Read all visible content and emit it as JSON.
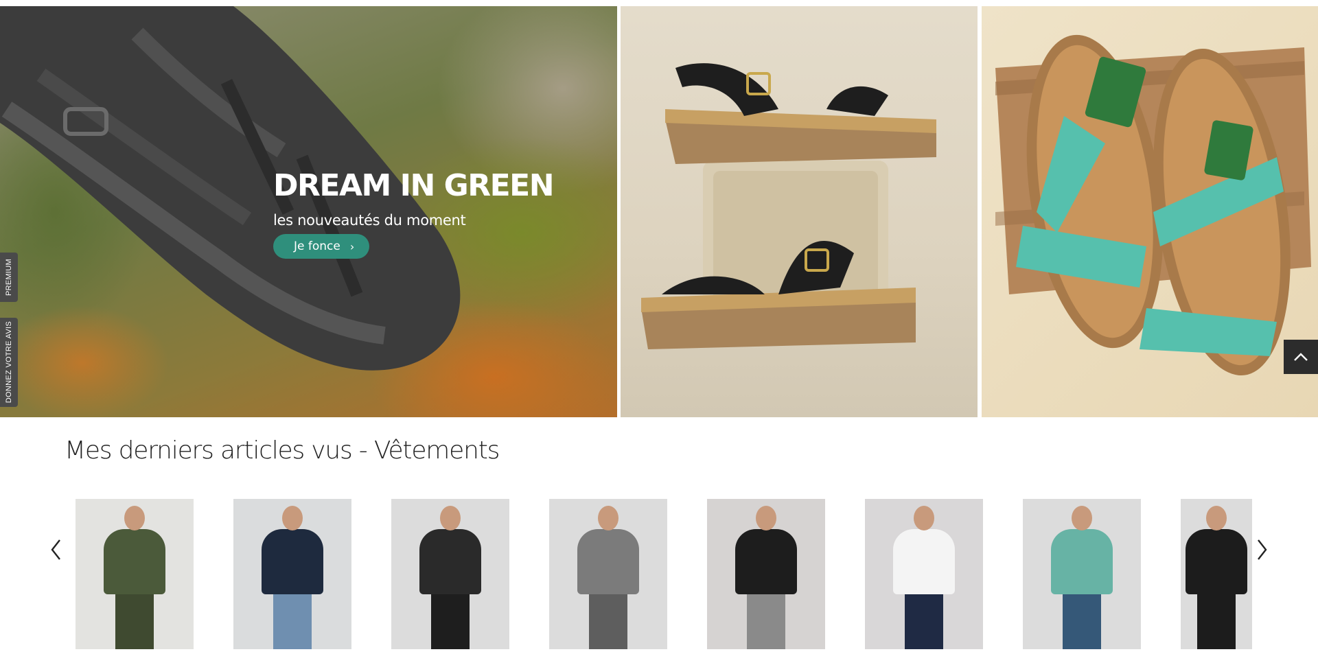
{
  "hero": {
    "title": "DREAM IN GREEN",
    "subtitle": "les nouveautés du moment",
    "cta_label": "Je fonce",
    "cta_icon": "chevron-right-icon",
    "accent_color": "#2f8f7c"
  },
  "side_tabs": {
    "premium": "PREMIUM",
    "review": "DONNEZ VOTRE AVIS"
  },
  "back_to_top_icon": "chevron-up-icon",
  "recent": {
    "title": "Mes derniers articles vus - Vêtements",
    "prev_icon": "chevron-left-icon",
    "next_icon": "chevron-right-icon",
    "products": [
      {
        "name": "khaki-tracksuit",
        "top_color": "#4b5a3a",
        "bottom_color": "#3f4a30",
        "bg": "#e3e3e0"
      },
      {
        "name": "striped-sweater-gilet",
        "top_color": "#1e2a3e",
        "bottom_color": "#6f8fb0",
        "bg": "#dadcdd"
      },
      {
        "name": "black-hoodie-olive-polo",
        "top_color": "#2a2a2a",
        "bottom_color": "#1e1e1e",
        "bg": "#dcdcdc"
      },
      {
        "name": "grey-tshirt",
        "top_color": "#7b7b7b",
        "bottom_color": "#5e5e5e",
        "bg": "#dcdcdc"
      },
      {
        "name": "black-leather-jacket",
        "top_color": "#1d1d1d",
        "bottom_color": "#8a8a8a",
        "bg": "#d6d3d2"
      },
      {
        "name": "white-tshirt",
        "top_color": "#f4f4f4",
        "bottom_color": "#1f2a44",
        "bg": "#d9d7d8"
      },
      {
        "name": "teal-graphic-tshirt",
        "top_color": "#67b3a5",
        "bottom_color": "#355878",
        "bg": "#dcdcdc"
      },
      {
        "name": "black-cardigan",
        "top_color": "#1c1c1c",
        "bottom_color": "#1c1c1c",
        "bg": "#dcdcdc"
      }
    ]
  }
}
